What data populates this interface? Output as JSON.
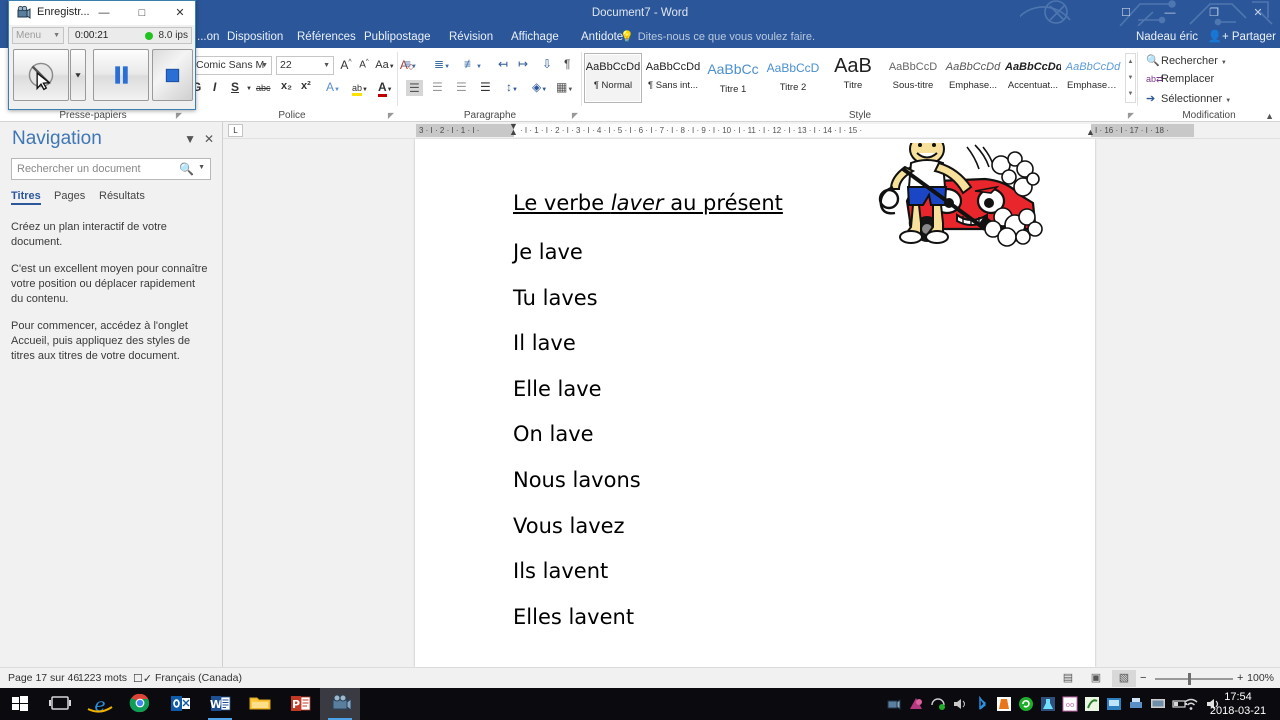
{
  "window": {
    "title": "Document7 - Word",
    "controls": [
      "ribbon-display-options",
      "minimize",
      "restore",
      "close"
    ]
  },
  "account": {
    "user": "Nadeau éric",
    "share_label": "Partager"
  },
  "ribbon": {
    "tabs": [
      "...on",
      "Disposition",
      "Références",
      "Publipostage",
      "Révision",
      "Affichage",
      "Antidote"
    ],
    "tell_me": "Dites-nous ce que vous voulez faire.",
    "groups": {
      "clipboard": {
        "label": "Presse-papiers"
      },
      "font": {
        "label": "Police",
        "font_name": "Comic Sans M",
        "font_size": "22",
        "grow_font": "A",
        "shrink_font": "A",
        "change_case": "Aa",
        "clear_format": "A",
        "bold": "G",
        "italic": "I",
        "underline": "S",
        "strikethrough": "abc",
        "subscript": "x₂",
        "superscript": "x²",
        "text_effects": "A",
        "highlight": "ab",
        "font_color": "A"
      },
      "paragraph": {
        "label": "Paragraphe"
      },
      "styles": {
        "label": "Style",
        "items": [
          {
            "preview": "AaBbCcDd",
            "name": "¶ Normal",
            "selected": true
          },
          {
            "preview": "AaBbCcDd",
            "name": "¶ Sans int...",
            "selected": false
          },
          {
            "preview": "AaBbCс",
            "name": "Titre 1",
            "selected": false
          },
          {
            "preview": "AaBbCcD",
            "name": "Titre 2",
            "selected": false
          },
          {
            "preview": "AaB",
            "name": "Titre",
            "selected": false
          },
          {
            "preview": "AaBbCcD",
            "name": "Sous-titre",
            "selected": false
          },
          {
            "preview": "AaBbCcDd",
            "name": "Emphase...",
            "selected": false
          },
          {
            "preview": "AaBbCcDd",
            "name": "Accentuat...",
            "selected": false
          },
          {
            "preview": "AaBbCcDd",
            "name": "Emphase i...",
            "selected": false
          }
        ]
      },
      "editing": {
        "label": "Modification",
        "find": "Rechercher",
        "replace": "Remplacer",
        "select": "Sélectionner"
      }
    }
  },
  "navigation": {
    "title": "Navigation",
    "search_placeholder": "Rechercher un document",
    "tabs": [
      "Titres",
      "Pages",
      "Résultats"
    ],
    "active_tab": "Titres",
    "body": [
      "Créez un plan interactif de votre document.",
      "C'est un excellent moyen pour connaître votre position ou déplacer rapidement du contenu.",
      "Pour commencer, accédez à l'onglet Accueil, puis appliquez des styles de titres aux titres de votre document."
    ]
  },
  "ruler": {
    "tab_selector": "L",
    "left_marks": "3  ·  I  ·  2  ·  I  ·  1  ·  I  ·",
    "right_marks": "·  I  ·  1  ·  I  ·  2  ·  I  ·  3  ·  I  ·  4  ·  I  ·  5  ·  I  ·  6  ·  I  ·  7  ·  I  ·  8  ·  I  ·  9  ·  I  · 10 ·  I  · 11 ·  I  · 12 ·  I  · 13 ·  I  · 14 ·  I  · 15 ·",
    "right_grey": "I  · 16 ·  I  · 17 ·  I  · 18 ·"
  },
  "document": {
    "heading_prefix": "Le verbe ",
    "heading_italic": "laver",
    "heading_suffix": " au présent",
    "lines": [
      "Je lave",
      "Tu laves",
      "Il lave",
      "Elle lave",
      "On lave",
      "Nous lavons",
      "Vous lavez",
      "Ils lavent",
      "Elles lavent"
    ],
    "clipart": "car-wash-clipart"
  },
  "status_bar": {
    "page": "Page 17 sur 46",
    "words": "1223 mots",
    "proofing": "proofing-icon",
    "language": "Français (Canada)",
    "views": [
      "read-mode",
      "print-layout",
      "web-layout"
    ],
    "active_view": "web-layout",
    "zoom": "100%"
  },
  "taskbar": {
    "items": [
      {
        "name": "start-button",
        "glyph": "start"
      },
      {
        "name": "task-view-button",
        "glyph": "taskview"
      },
      {
        "name": "internet-explorer",
        "glyph": "ie"
      },
      {
        "name": "google-chrome",
        "glyph": "chrome"
      },
      {
        "name": "outlook",
        "glyph": "outlook"
      },
      {
        "name": "word",
        "glyph": "word"
      },
      {
        "name": "file-explorer",
        "glyph": "folder"
      },
      {
        "name": "powerpoint",
        "glyph": "powerpoint"
      },
      {
        "name": "screen-recorder",
        "glyph": "recorder"
      }
    ],
    "clock_time": "17:54",
    "clock_date": "2018-03-21"
  },
  "recorder": {
    "title": "Enregistr...",
    "menu_label": "Menu",
    "timer": "0:00:21",
    "fps": "8.0 ips",
    "buttons": [
      "record",
      "record-options",
      "pause",
      "stop"
    ],
    "window_controls": [
      "minimize",
      "maximize",
      "close"
    ]
  },
  "colors": {
    "word_blue": "#2b579a",
    "accent": "#3f76b5",
    "taskbar": "#0b0b0f",
    "rec_green": "#22c321"
  }
}
